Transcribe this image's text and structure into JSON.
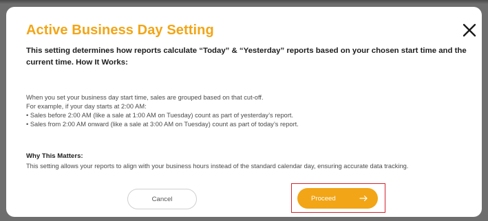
{
  "dialog": {
    "title": "Active Business Day Setting",
    "close_icon": "close-icon",
    "intro": "This setting determines how reports calculate “Today” & “Yesterday” reports based on your chosen start time and the current time. How It Works:",
    "body_lines": [
      "When you set your business day start time, sales are grouped based on that cut-off.",
      "For example, if your day starts at 2:00 AM:",
      "• Sales before 2:00 AM (like a sale at 1:00 AM on Tuesday) count as part of yesterday’s report.",
      "• Sales from 2:00 AM onward (like a sale at 3:00 AM on Tuesday) count as part of today’s report."
    ],
    "why_title": "Why This Matters:",
    "why_text": "This setting allows your reports to align with your business hours instead of the standard calendar day, ensuring accurate data tracking.",
    "buttons": {
      "cancel_label": "Cancel",
      "proceed_label": "Proceed",
      "proceed_icon": "arrow-right-icon"
    }
  },
  "colors": {
    "accent": "#f2a516",
    "highlight": "#d6202a",
    "text_dark": "#1d1d1d",
    "text_body": "#4a4a4a"
  }
}
